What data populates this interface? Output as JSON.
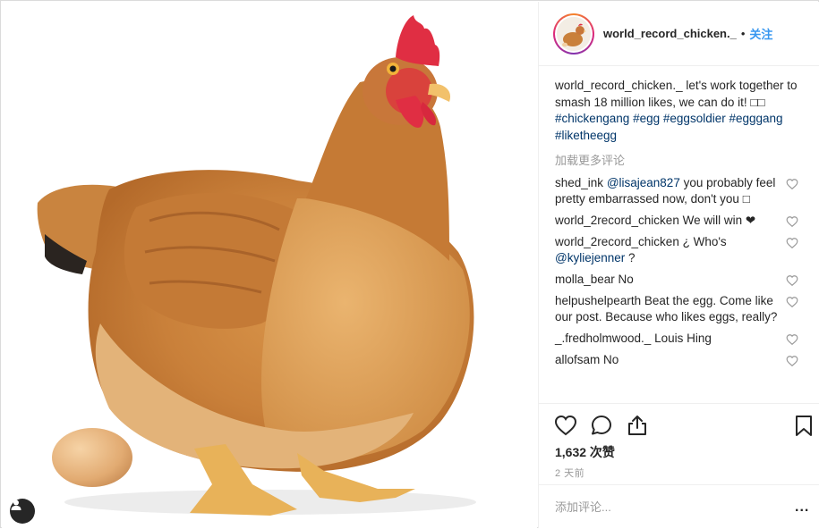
{
  "post": {
    "username": "world_record_chicken._",
    "follow_label": "关注",
    "separator": "•",
    "image_subject": "chicken-and-egg-photo",
    "tag_user_icon": "user-icon"
  },
  "caption": {
    "username": "world_record_chicken._",
    "text": " let's work together to smash 18 million likes, we can do it! □□",
    "hashtags": [
      "#chickengang",
      "#egg",
      "#eggsoldier",
      "#egggang",
      "#liketheegg"
    ]
  },
  "load_more_label": "加载更多评论",
  "comments": [
    {
      "user": "shed_ink",
      "mention": "@lisajean827",
      "text": " you probably feel pretty embarrassed now, don't you □"
    },
    {
      "user": "world_2record_chicken",
      "mention": "",
      "text": " We will win ❤"
    },
    {
      "user": "world_2record_chicken",
      "mention": "",
      "text": " ¿ Who's ",
      "mention_after": "@kyliejenner",
      "text_after": " ?"
    },
    {
      "user": "molla_bear",
      "mention": "",
      "text": " No"
    },
    {
      "user": "helpushelpearth",
      "mention": "",
      "text": " Beat the egg. Come like our post. Because who likes eggs, really?"
    },
    {
      "user": "_.fredholmwood._",
      "mention": "",
      "text": " Louis Hing"
    },
    {
      "user": "allofsam",
      "mention": "",
      "text": " No"
    }
  ],
  "actions": {
    "like_icon": "heart-icon",
    "comment_icon": "comment-icon",
    "share_icon": "share-icon",
    "save_icon": "bookmark-icon"
  },
  "likes_text": "1,632 次赞",
  "time_text": "2 天前",
  "add_comment": {
    "placeholder": "添加评论...",
    "more_label": "..."
  },
  "colors": {
    "link": "#3897f0",
    "hashtag": "#003569",
    "muted": "#999999",
    "text": "#262626"
  }
}
